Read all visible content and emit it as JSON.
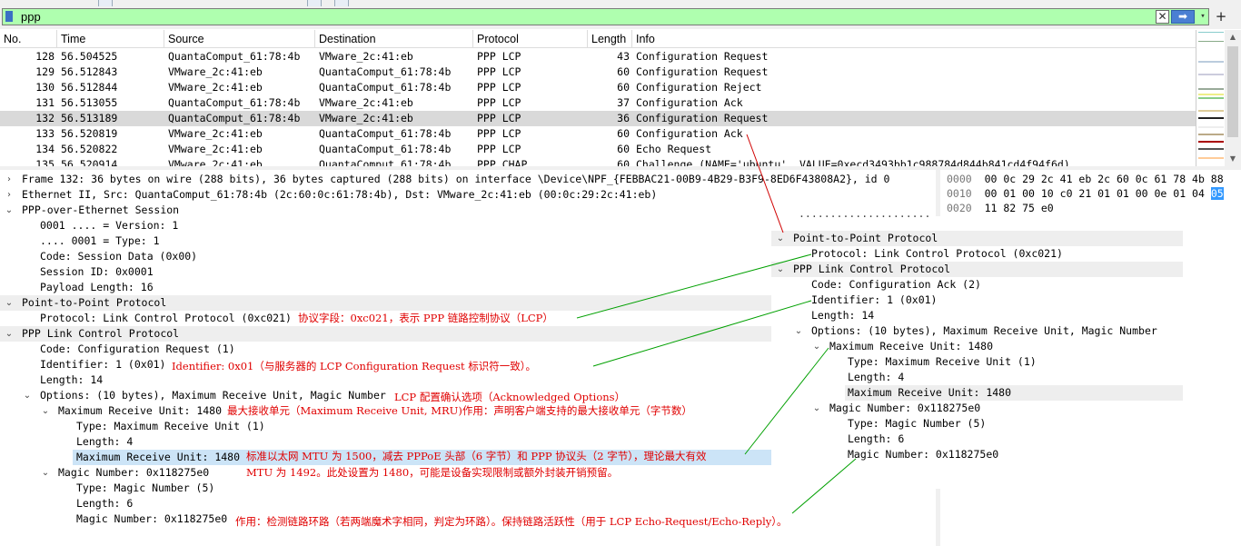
{
  "filter": {
    "value": "ppp",
    "clear_glyph": "✕",
    "apply_glyph": "➡",
    "dropdown_glyph": "▾",
    "add_glyph": "+"
  },
  "columns": [
    "No.",
    "Time",
    "Source",
    "Destination",
    "Protocol",
    "Length",
    "Info"
  ],
  "packets": [
    {
      "no": "128",
      "time": "56.504525",
      "src": "QuantaComput_61:78:4b",
      "dst": "VMware_2c:41:eb",
      "proto": "PPP LCP",
      "len": "43",
      "info": "Configuration Request"
    },
    {
      "no": "129",
      "time": "56.512843",
      "src": "VMware_2c:41:eb",
      "dst": "QuantaComput_61:78:4b",
      "proto": "PPP LCP",
      "len": "60",
      "info": "Configuration Request"
    },
    {
      "no": "130",
      "time": "56.512844",
      "src": "VMware_2c:41:eb",
      "dst": "QuantaComput_61:78:4b",
      "proto": "PPP LCP",
      "len": "60",
      "info": "Configuration Reject"
    },
    {
      "no": "131",
      "time": "56.513055",
      "src": "QuantaComput_61:78:4b",
      "dst": "VMware_2c:41:eb",
      "proto": "PPP LCP",
      "len": "37",
      "info": "Configuration Ack"
    },
    {
      "no": "132",
      "time": "56.513189",
      "src": "QuantaComput_61:78:4b",
      "dst": "VMware_2c:41:eb",
      "proto": "PPP LCP",
      "len": "36",
      "info": "Configuration Request"
    },
    {
      "no": "133",
      "time": "56.520819",
      "src": "VMware_2c:41:eb",
      "dst": "QuantaComput_61:78:4b",
      "proto": "PPP LCP",
      "len": "60",
      "info": "Configuration Ack"
    },
    {
      "no": "134",
      "time": "56.520822",
      "src": "VMware_2c:41:eb",
      "dst": "QuantaComput_61:78:4b",
      "proto": "PPP LCP",
      "len": "60",
      "info": "Echo Request"
    },
    {
      "no": "135",
      "time": "56.520914",
      "src": "VMware_2c:41:eb",
      "dst": "QuantaComput_61:78:4b",
      "proto": "PPP CHAP",
      "len": "60",
      "info": "Challenge (NAME='ubuntu', VALUE=0xecd3493bb1c988784d844b841cd4f94f6d)"
    }
  ],
  "details": {
    "frame": "Frame 132: 36 bytes on wire (288 bits), 36 bytes captured (288 bits) on interface \\Device\\NPF_{FEBBAC21-00B9-4B29-B3F9-8ED6F43808A2}, id 0",
    "ethernet": "Ethernet II, Src: QuantaComput_61:78:4b (2c:60:0c:61:78:4b), Dst: VMware_2c:41:eb (00:0c:29:2c:41:eb)",
    "pppoe": "PPP-over-Ethernet Session",
    "pppoe_fields": [
      "0001 .... = Version: 1",
      ".... 0001 = Type: 1",
      "Code: Session Data (0x00)",
      "Session ID: 0x0001",
      "Payload Length: 16"
    ],
    "ppp": "Point-to-Point Protocol",
    "ppp_protocol": "Protocol: Link Control Protocol (0xc021)",
    "lcp": "PPP Link Control Protocol",
    "lcp_code": "Code: Configuration Request (1)",
    "lcp_id": "Identifier: 1 (0x01)",
    "lcp_len": "Length: 14",
    "options": "Options: (10 bytes), Maximum Receive Unit, Magic Number",
    "mru": "Maximum Receive Unit: 1480",
    "mru_type": "Type: Maximum Receive Unit (1)",
    "mru_len": "Length: 4",
    "mru_val": "Maximum Receive Unit: 1480",
    "magic": "Magic Number: 0x118275e0",
    "magic_type": "Type: Magic Number (5)",
    "magic_len": "Length: 6",
    "magic_val": "Magic Number: 0x118275e0"
  },
  "bytes": [
    {
      "off": "0000",
      "hex": "00 0c 29 2c 41 eb 2c 60  0c 61 78 4b 88",
      "sel": ""
    },
    {
      "off": "0010",
      "hex": "00 01 00 10 c0 21 01 01  00 0e 01 04",
      "sel": "05"
    },
    {
      "off": "0020",
      "hex": "11 82 75 e0",
      "sel": ""
    }
  ],
  "overlay": {
    "ppp": "Point-to-Point Protocol",
    "ppp_protocol": "Protocol: Link Control Protocol (0xc021)",
    "lcp": "PPP Link Control Protocol",
    "lcp_code": "Code: Configuration Ack (2)",
    "lcp_id": "Identifier: 1 (0x01)",
    "lcp_len": "Length: 14",
    "options": "Options: (10 bytes), Maximum Receive Unit, Magic Number",
    "mru": "Maximum Receive Unit: 1480",
    "mru_type": "Type: Maximum Receive Unit (1)",
    "mru_len": "Length: 4",
    "mru_val": "Maximum Receive Unit: 1480",
    "magic": "Magic Number: 0x118275e0",
    "magic_type": "Type: Magic Number (5)",
    "magic_len": "Length: 6",
    "magic_val": "Magic Number: 0x118275e0"
  },
  "annotations": {
    "protocol": "协议字段：0xc021，表示 PPP 链路控制协议（LCP）",
    "identifier": "Identifier: 0x01（与服务器的 LCP Configuration Request 标识符一致）。",
    "options": "LCP 配置确认选项（Acknowledged Options）",
    "mru": "最大接收单元（Maximum Receive Unit, MRU)作用：声明客户端支持的最大接收单元（字节数）",
    "mru_note_1": "标准以太网 MTU 为 1500，减去 PPPoE 头部（6 字节）和 PPP 协议头（2 字节），理论最大有效",
    "mru_note_2": "MTU 为 1492。此处设置为 1480，可能是设备实现限制或额外封装开销预留。",
    "magic": "作用：检测链路环路（若两端魔术字相同，判定为环路）。保持链路活跃性（用于 LCP Echo-Request/Echo-Reply）。"
  },
  "colors": {
    "filter_ok": "#afffaf",
    "selected_row": "#d9d9d9",
    "selected_field": "#cce4f7",
    "annotation": "#e00000",
    "line_green": "#00a000",
    "line_red": "#d00000",
    "byte_sel": "#3399ff"
  }
}
